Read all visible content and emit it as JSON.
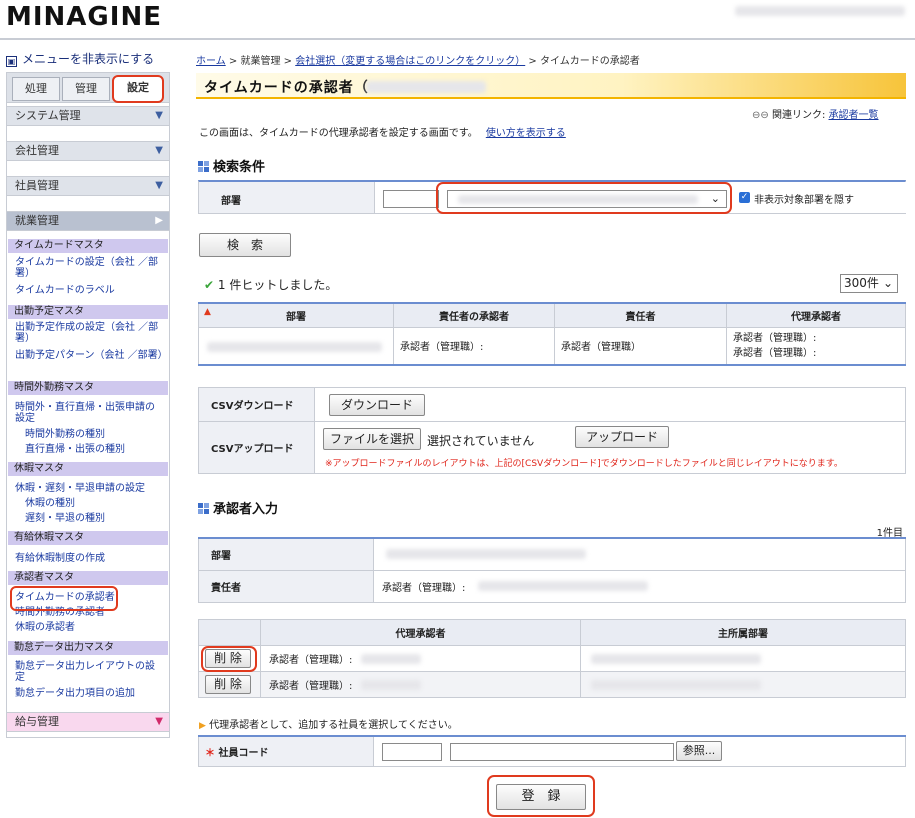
{
  "header": {
    "logo": "MINAGINE"
  },
  "sidebar": {
    "toggle": "メニューを非表示にする",
    "tabs": [
      "処理",
      "管理",
      "設定"
    ],
    "groups": {
      "system": "システム管理",
      "company": "会社管理",
      "employee": "社員管理",
      "work": "就業管理",
      "salary": "給与管理"
    },
    "sections": {
      "timecard": "タイムカードマスタ",
      "schedule": "出勤予定マスタ",
      "overtime": "時間外勤務マスタ",
      "leave": "休暇マスタ",
      "paid": "有給休暇マスタ",
      "approver": "承認者マスタ",
      "export": "勤怠データ出力マスタ"
    },
    "links": {
      "tc_setting": "タイムカードの設定（会社 ／部署）",
      "tc_label": "タイムカードのラベル",
      "sch_setting": "出勤予定作成の設定（会社 ／部署）",
      "sch_pattern": "出勤予定パターン（会社 ／部署）",
      "ot_setting": "時間外・直行直帰・出張申請の設定",
      "ot_type": "時間外勤務の種別",
      "direct_type": "直行直帰・出張の種別",
      "lv_setting": "休暇・遅刻・早退申請の設定",
      "lv_type": "休暇の種別",
      "late_type": "遅刻・早退の種別",
      "paid_make": "有給休暇制度の作成",
      "ap_timecard": "タイムカードの承認者",
      "ap_overtime": "時間外勤務の承認者",
      "ap_leave": "休暇の承認者",
      "ex_layout": "勤怠データ出力レイアウトの設定",
      "ex_items": "勤怠データ出力項目の追加"
    }
  },
  "breadcrumb": {
    "home": "ホーム",
    "work": "就業管理",
    "company": "会社選択（変更する場合はこのリンクをクリック）",
    "current": "タイムカードの承認者",
    "sep": ">"
  },
  "title": "タイムカードの承認者（",
  "related": {
    "label": "関連リンク:",
    "link": "承認者一覧"
  },
  "desc": {
    "text": "この画面は、タイムカードの代理承認者を設定する画面です。",
    "link": "使い方を表示する"
  },
  "search": {
    "heading": "検索条件",
    "dept_label": "部署",
    "hide_label": "非表示対象部署を隠す",
    "search_button": "検　索",
    "result": "1 件ヒットしました。",
    "per_page": "300件",
    "columns": [
      "部署",
      "責任者の承認者",
      "責任者",
      "代理承認者"
    ],
    "row": {
      "approver": "承認者（管理職）:",
      "manager": "承認者（管理職）",
      "proxy1": "承認者（管理職）:",
      "proxy2": "承認者（管理職）:"
    }
  },
  "csv": {
    "download_label": "CSVダウンロード",
    "download_button": "ダウンロード",
    "upload_label": "CSVアップロード",
    "file_button": "ファイルを選択",
    "file_status": "選択されていません",
    "upload_button": "アップロード",
    "note": "※アップロードファイルのレイアウトは、上記の[CSVダウンロード]でダウンロードしたファイルと同じレイアウトになります。"
  },
  "approver": {
    "heading": "承認者入力",
    "count": "1件目",
    "dept_label": "部署",
    "manager_label": "責任者",
    "manager_value": "承認者（管理職）:",
    "col_proxy": "代理承認者",
    "col_dept": "主所属部署",
    "rows": [
      {
        "delete": "削 除",
        "name": "承認者（管理職）:"
      },
      {
        "delete": "削 除",
        "name": "承認者（管理職）:"
      }
    ],
    "instruction": "代理承認者として、追加する社員を選択してください。",
    "code_label": "社員コード",
    "browse": "参照...",
    "submit": "登　録"
  },
  "colors": {
    "accent": "#e03a1e",
    "link": "#1a3aa0",
    "section": "#cfc8ee",
    "title_gradient_end": "#f7c43a"
  }
}
